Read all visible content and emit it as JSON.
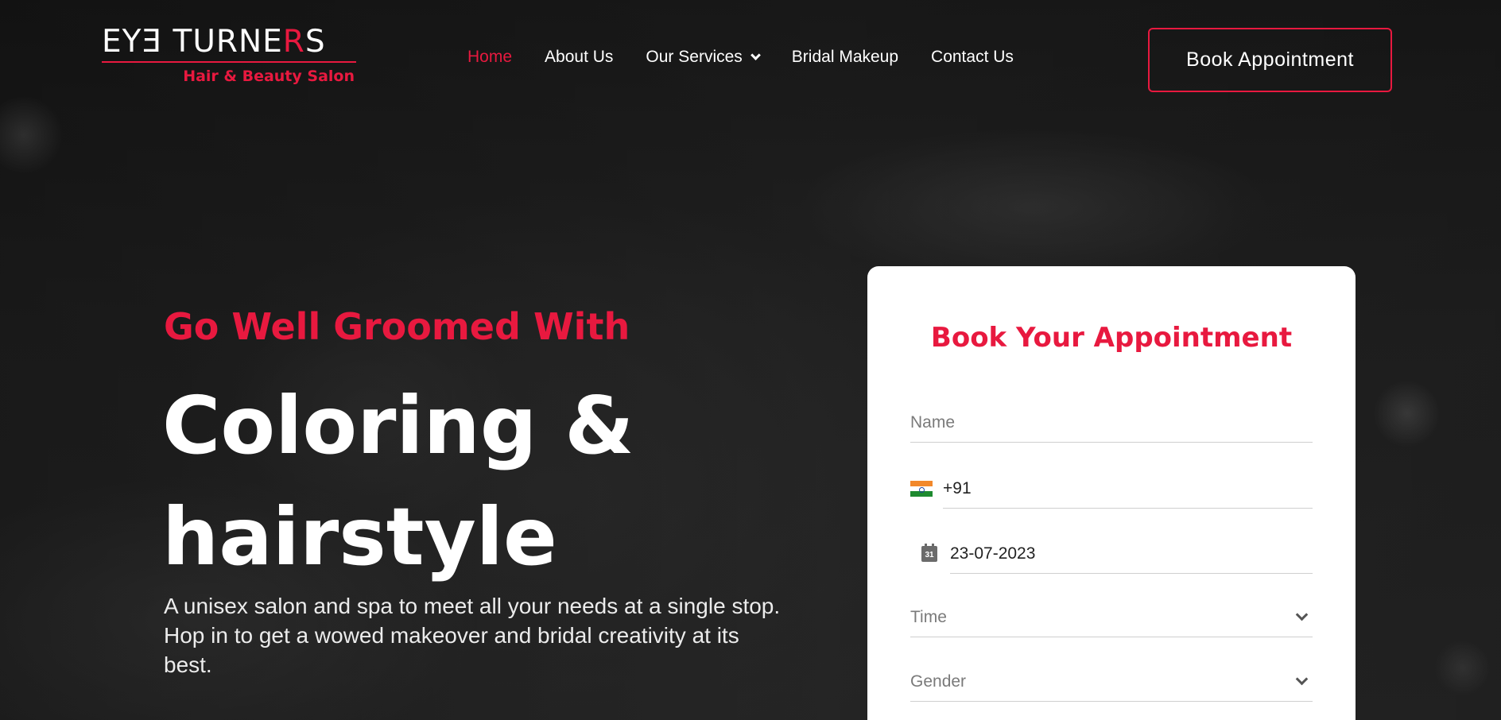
{
  "brand": {
    "logo_text_part1": "EYƎ TURNE",
    "logo_text_r": "R",
    "logo_text_part2": "S",
    "tagline": "Hair & Beauty Salon",
    "accent_color": "#e8193f"
  },
  "nav": {
    "items": [
      {
        "label": "Home",
        "active": true
      },
      {
        "label": "About Us",
        "active": false
      },
      {
        "label": "Our Services",
        "active": false,
        "has_dropdown": true
      },
      {
        "label": "Bridal Makeup",
        "active": false
      },
      {
        "label": "Contact Us",
        "active": false
      }
    ],
    "cta_label": "Book Appointment"
  },
  "hero": {
    "subheading": "Go Well Groomed With",
    "title_line1": "Coloring &",
    "title_line2": "hairstyle",
    "description": "A unisex salon and spa to meet all your needs at a single stop. Hop in to get a wowed makeover and bridal creativity at its best."
  },
  "booking_form": {
    "title": "Book Your Appointment",
    "name_placeholder": "Name",
    "phone_code": "+91",
    "phone_flag_icon": "india-flag-icon",
    "date_icon": "calendar-icon",
    "calendar_day": "31",
    "date_value": "23-07-2023",
    "time_placeholder": "Time",
    "gender_placeholder": "Gender"
  }
}
